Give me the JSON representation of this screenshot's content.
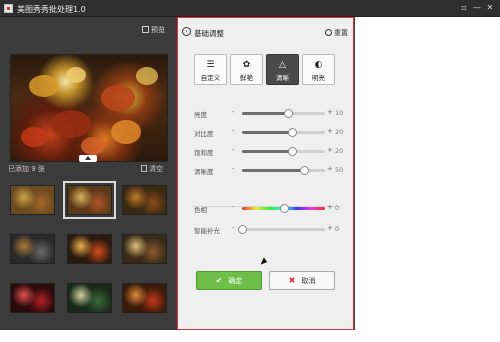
{
  "window": {
    "title": "美图秀秀批处理1.0",
    "controls": [
      "▫",
      "—",
      "✕"
    ]
  },
  "left_panel": {
    "original_label": "预览",
    "added_label": "已添加 9 张",
    "clear_label": "清空",
    "thumbnails": [
      {
        "colors": [
          "#6a4a1e",
          "#a8652a",
          "#c9a24a"
        ]
      },
      {
        "colors": [
          "#5a3a18",
          "#b0542a",
          "#d9b45a"
        ],
        "selected": true
      },
      {
        "colors": [
          "#3a2a12",
          "#8a4a1a",
          "#c07a2a"
        ]
      },
      {
        "colors": [
          "#2a2a2a",
          "#6a6a6a",
          "#b07a3a"
        ]
      },
      {
        "colors": [
          "#2a1a0e",
          "#d04a1a",
          "#f0b050"
        ]
      },
      {
        "colors": [
          "#3a2a1a",
          "#8a5a2a",
          "#e0c07a"
        ]
      },
      {
        "colors": [
          "#2a0a0a",
          "#b02020",
          "#e05050"
        ]
      },
      {
        "colors": [
          "#1a2a1a",
          "#3a6a3a",
          "#d0d0a0"
        ]
      },
      {
        "colors": [
          "#3a1a0a",
          "#c0381a",
          "#e08a3a"
        ]
      }
    ]
  },
  "adjust_panel": {
    "title": "基础调整",
    "reset_label": "重置",
    "modes": [
      {
        "label": "自定义",
        "icon": "sliders-icon",
        "glyph": "☰",
        "active": false
      },
      {
        "label": "鲜艳",
        "icon": "flower-icon",
        "glyph": "✿",
        "active": false
      },
      {
        "label": "清晰",
        "icon": "triangle-icon",
        "glyph": "△",
        "active": true
      },
      {
        "label": "明亮",
        "icon": "contrast-icon",
        "glyph": "◐",
        "active": false
      }
    ],
    "sliders": [
      {
        "label": "亮度",
        "value": "10",
        "position": 0.55
      },
      {
        "label": "对比度",
        "value": "20",
        "position": 0.6
      },
      {
        "label": "饱和度",
        "value": "20",
        "position": 0.6
      },
      {
        "label": "清晰度",
        "value": "50",
        "position": 0.75
      }
    ],
    "color_sliders": [
      {
        "label": "色相",
        "value": "0",
        "position": 0.5,
        "hue": true
      },
      {
        "label": "智能补光",
        "value": "0",
        "position": 0.0,
        "hue": false
      }
    ],
    "ok_label": "确定",
    "cancel_label": "取消"
  },
  "colors": {
    "accent_red": "#e0343f",
    "ok_green": "#6dbf4a",
    "window_dark": "#3a3a3a"
  }
}
